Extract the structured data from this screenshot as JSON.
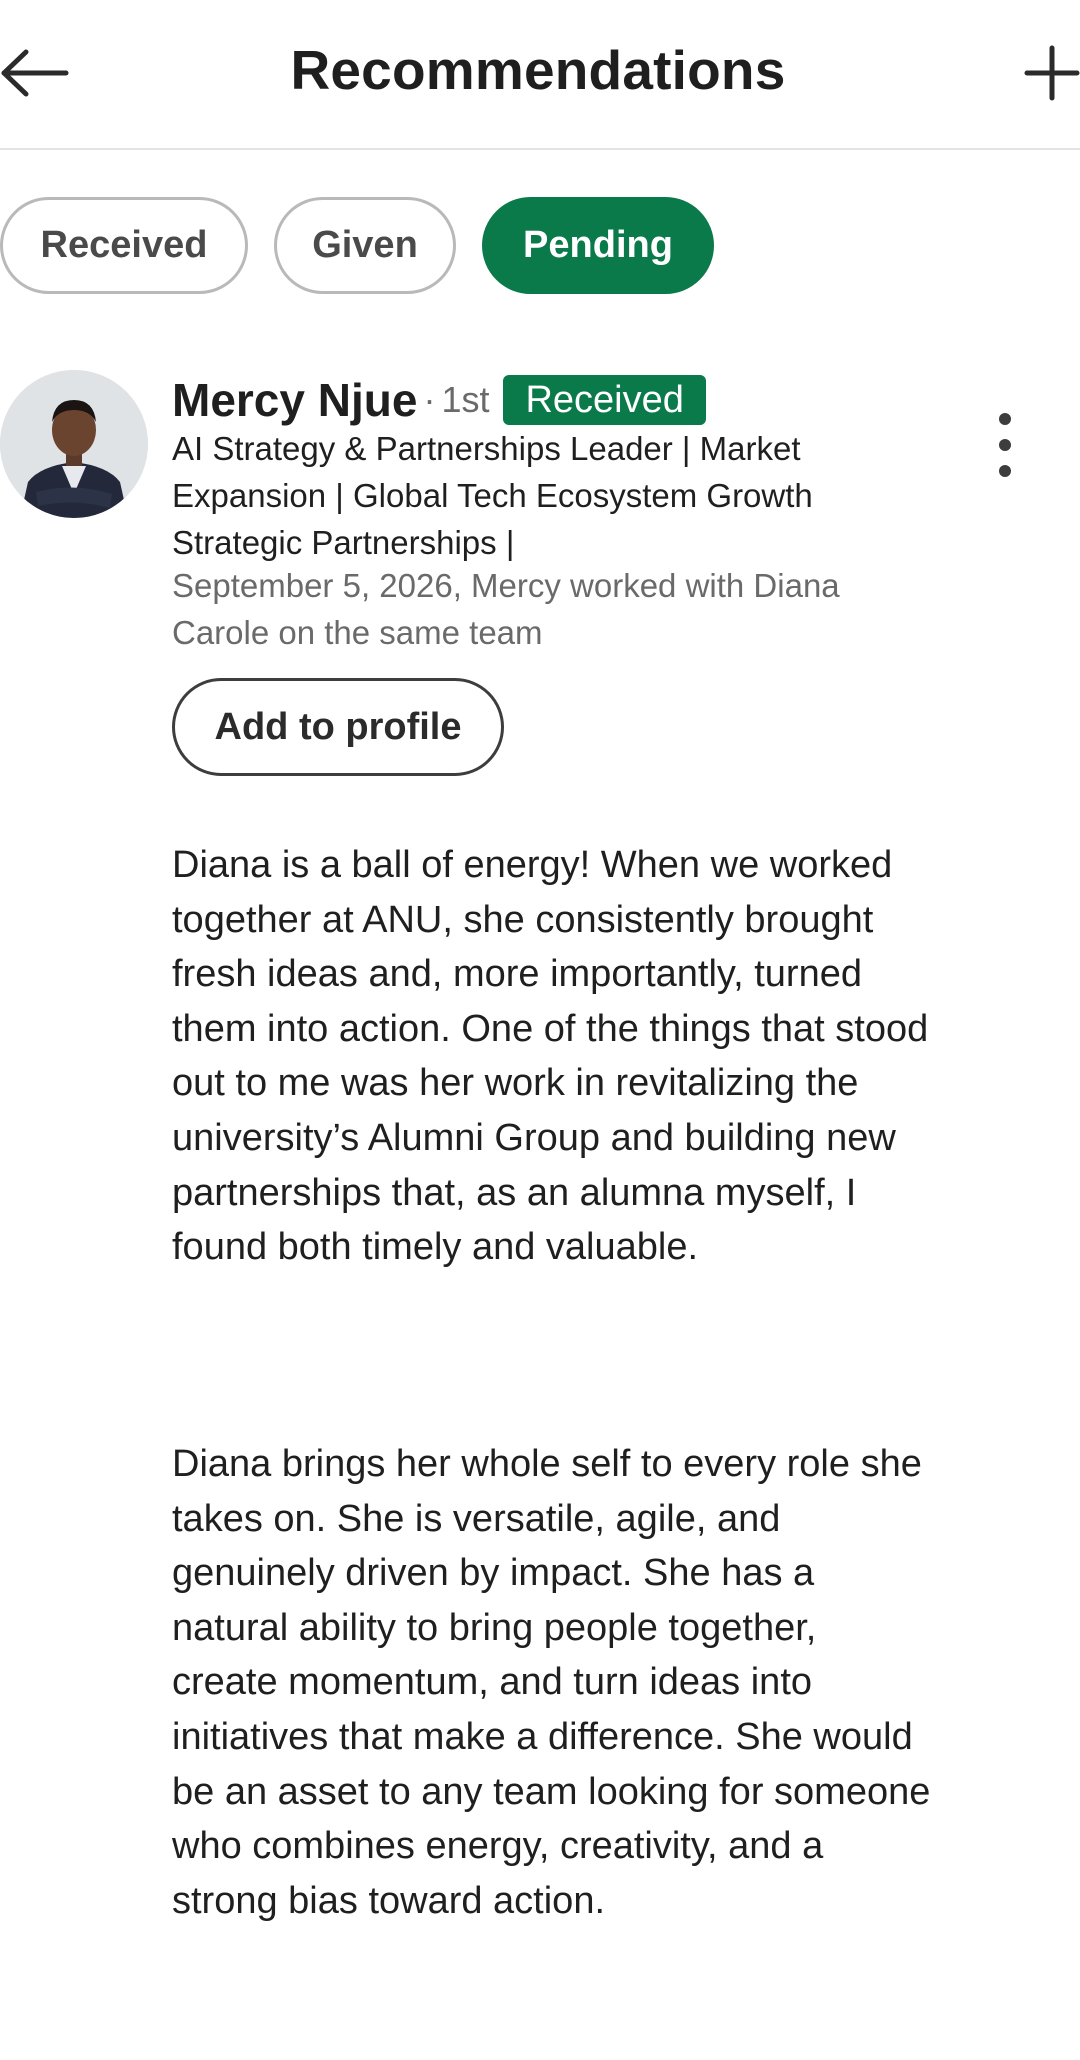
{
  "header": {
    "title": "Recommendations",
    "back_icon": "arrow-left-icon",
    "add_icon": "plus-icon"
  },
  "tabs": [
    {
      "label": "Received",
      "selected": false
    },
    {
      "label": "Given",
      "selected": false
    },
    {
      "label": "Pending",
      "selected": true
    }
  ],
  "recommendation": {
    "name": "Mercy Njue",
    "separator": "·",
    "degree": "1st",
    "status": "Received",
    "headline": "AI Strategy & Partnerships Leader | Market Expansion | Global Tech Ecosystem Growth Strategic Partnerships |",
    "meta": "September 5, 2026, Mercy worked with Diana Carole on the same team",
    "add_button": "Add to profile",
    "paragraphs": [
      "Diana is a ball of energy! When we worked together at ANU, she consistently brought fresh ideas and, more importantly, turned them into action. One of the things that stood out to me was her work in revitalizing the university’s Alumni Group and building new partnerships that, as an alumna myself, I found both timely and valuable.",
      "Diana brings her whole self to every role she takes on. She is versatile, agile, and genuinely driven by impact. She has a natural ability to bring people together, create momentum, and turn ideas into initiatives that make a difference. She would be an asset to any team looking for someone who combines energy, creativity, and a strong bias toward action."
    ]
  },
  "colors": {
    "accent_green": "#0a7a4b",
    "text_primary": "#1f1f1f",
    "text_secondary": "#6a6a6a"
  }
}
